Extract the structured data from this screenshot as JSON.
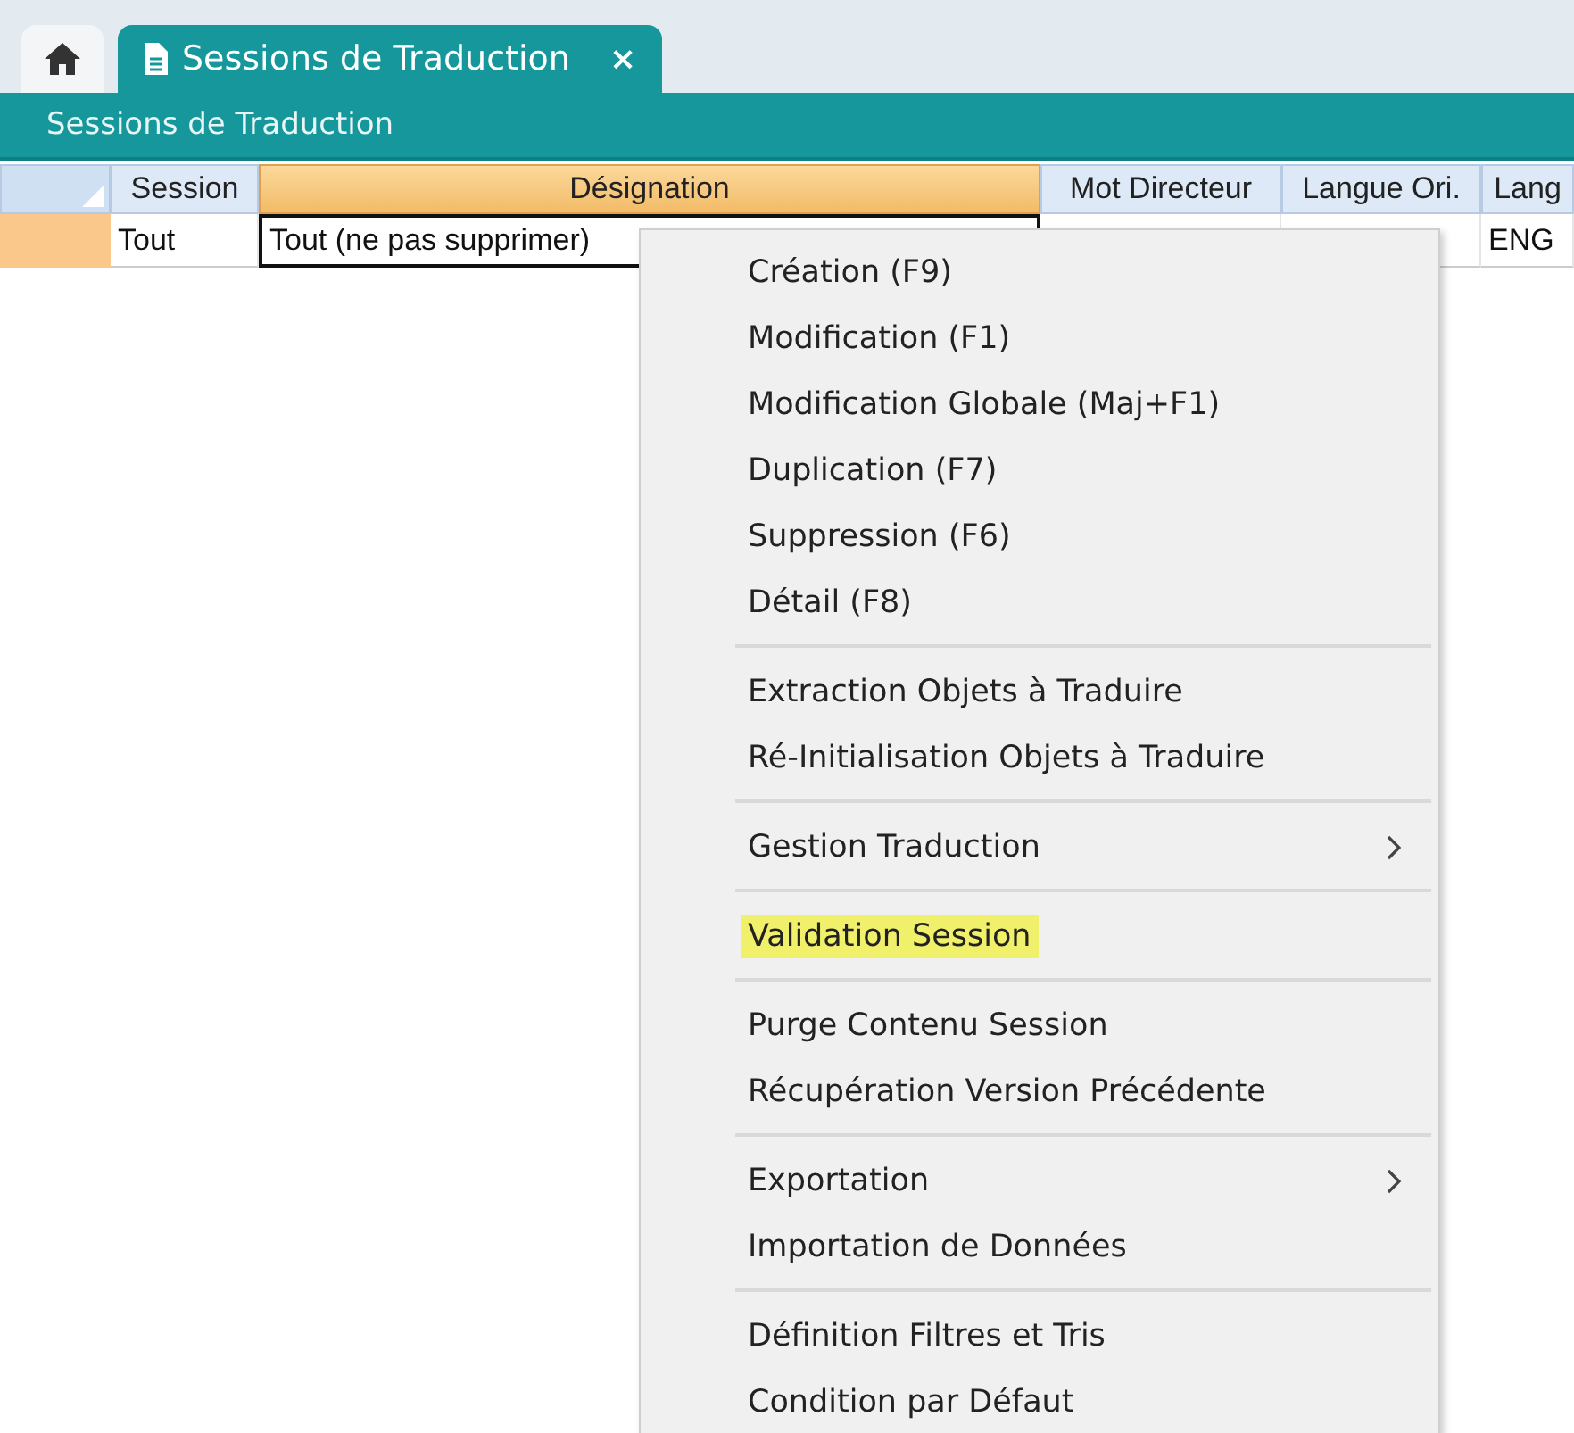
{
  "tabs": [
    {
      "kind": "home",
      "selected": false
    },
    {
      "kind": "document",
      "label": "Sessions de Traduction",
      "selected": true,
      "close_glyph": "×"
    }
  ],
  "panel": {
    "title": "Sessions de Traduction"
  },
  "table": {
    "columns": [
      {
        "label": "Session",
        "sorted": false
      },
      {
        "label": "Désignation",
        "sorted": true
      },
      {
        "label": "Mot Directeur",
        "sorted": false
      },
      {
        "label": "Langue Ori.",
        "sorted": false
      },
      {
        "label": "Lang",
        "sorted": false
      }
    ],
    "rows": [
      {
        "selected": true,
        "cells": [
          "Tout",
          "Tout (ne pas supprimer)",
          "",
          "",
          "ENG"
        ]
      }
    ]
  },
  "context_menu": {
    "groups": [
      {
        "items": [
          {
            "label": "Création (F9)",
            "submenu": false,
            "highlighted": false
          },
          {
            "label": "Modification (F1)",
            "submenu": false,
            "highlighted": false
          },
          {
            "label": "Modification Globale (Maj+F1)",
            "submenu": false,
            "highlighted": false
          },
          {
            "label": "Duplication (F7)",
            "submenu": false,
            "highlighted": false
          },
          {
            "label": "Suppression (F6)",
            "submenu": false,
            "highlighted": false
          },
          {
            "label": "Détail (F8)",
            "submenu": false,
            "highlighted": false
          }
        ]
      },
      {
        "items": [
          {
            "label": "Extraction Objets à Traduire",
            "submenu": false,
            "highlighted": false
          },
          {
            "label": "Ré-Initialisation Objets à Traduire",
            "submenu": false,
            "highlighted": false
          }
        ]
      },
      {
        "items": [
          {
            "label": "Gestion Traduction",
            "submenu": true,
            "highlighted": false
          }
        ]
      },
      {
        "items": [
          {
            "label": "Validation Session",
            "submenu": false,
            "highlighted": true
          }
        ]
      },
      {
        "items": [
          {
            "label": "Purge Contenu Session",
            "submenu": false,
            "highlighted": false
          },
          {
            "label": "Récupération Version Précédente",
            "submenu": false,
            "highlighted": false
          }
        ]
      },
      {
        "items": [
          {
            "label": "Exportation",
            "submenu": true,
            "highlighted": false
          },
          {
            "label": "Importation de Données",
            "submenu": false,
            "highlighted": false
          }
        ]
      },
      {
        "items": [
          {
            "label": "Définition Filtres et Tris",
            "submenu": false,
            "highlighted": false
          },
          {
            "label": "Condition par Défaut",
            "submenu": false,
            "highlighted": false
          }
        ]
      }
    ]
  }
}
